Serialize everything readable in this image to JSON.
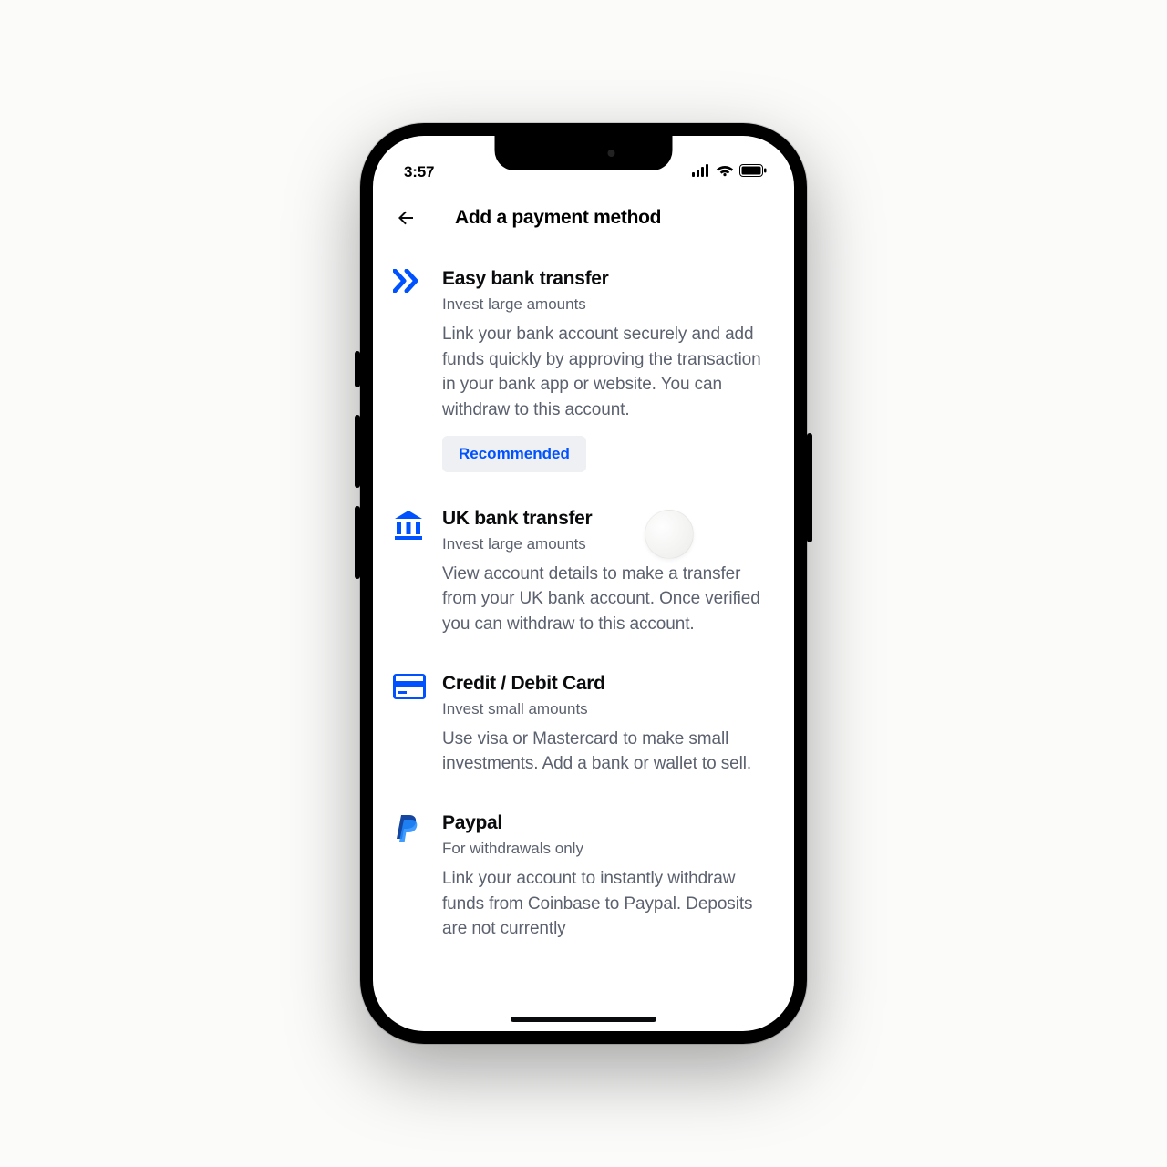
{
  "status": {
    "time": "3:57"
  },
  "header": {
    "title": "Add a payment method"
  },
  "items": [
    {
      "title": "Easy bank transfer",
      "subtitle": "Invest large amounts",
      "description": "Link your bank account securely and add funds quickly by approving the transaction in your bank app or website. You can withdraw to this account.",
      "badge": "Recommended"
    },
    {
      "title": "UK bank transfer",
      "subtitle": "Invest large amounts",
      "description": "View account details to make a transfer from your UK bank account. Once verified you can withdraw to this account."
    },
    {
      "title": "Credit / Debit Card",
      "subtitle": "Invest small amounts",
      "description": "Use visa or Mastercard to make small investments. Add a bank or wallet to sell."
    },
    {
      "title": "Paypal",
      "subtitle": "For withdrawals only",
      "description": "Link your account to instantly withdraw funds from Coinbase to Paypal. Deposits are not currently"
    }
  ],
  "colors": {
    "accent": "#0052ff"
  }
}
